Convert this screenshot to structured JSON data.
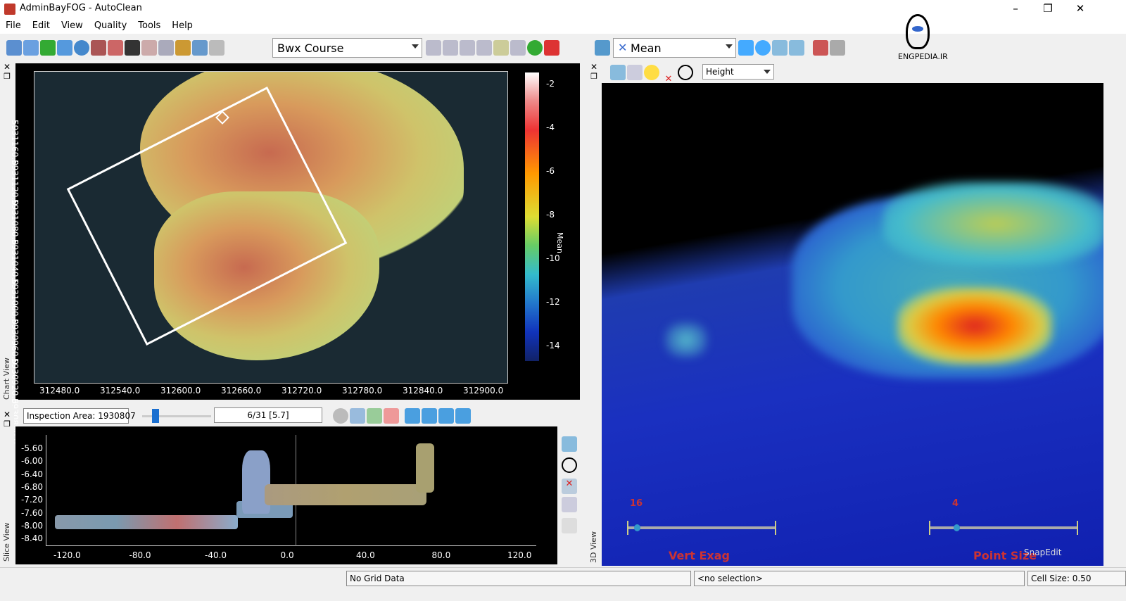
{
  "window": {
    "title": "AdminBayFOG - AutoClean"
  },
  "menu": [
    "File",
    "Edit",
    "View",
    "Quality",
    "Tools",
    "Help"
  ],
  "toolbar": {
    "surface_combo": "Bwx Course",
    "mean_combo": "Mean",
    "attribute_combo": "Height"
  },
  "logo": {
    "text": "ENGPEDIA.IR"
  },
  "chart_view": {
    "panel_label": "Chart View",
    "x_ticks": [
      "312480.0",
      "312540.0",
      "312600.0",
      "312660.0",
      "312720.0",
      "312780.0",
      "312840.0",
      "312900.0"
    ],
    "y_ticks": [
      "5931160.0",
      "5931120.0",
      "5931080.0",
      "5931040.0",
      "5931000.0",
      "5930960.0",
      "5930920.0",
      "5930880.0"
    ],
    "colorbar_ticks": [
      "-2",
      "-4",
      "-6",
      "-8",
      "-10",
      "-12",
      "-14"
    ],
    "colorbar_label": "Mean"
  },
  "slice_toolbar": {
    "inspection_area": "Inspection Area: 1930807",
    "slider_value": "6/31 [5.7]"
  },
  "slice_view": {
    "panel_label": "Slice View",
    "y_ticks": [
      "-5.60",
      "-6.00",
      "-6.40",
      "-6.80",
      "-7.20",
      "-7.60",
      "-8.00",
      "-8.40"
    ],
    "x_ticks": [
      "-120.0",
      "-80.0",
      "-40.0",
      "0.0",
      "40.0",
      "80.0",
      "120.0"
    ]
  },
  "view3d": {
    "panel_label": "3D View",
    "vert_exag_label": "Vert Exag",
    "vert_exag_value": "16",
    "point_size_label": "Point Size",
    "point_size_value": "4",
    "watermark": "SnapEdit"
  },
  "status": {
    "grid": "No Grid Data",
    "selection": "<no selection>",
    "cell_size": "Cell Size: 0.50"
  }
}
